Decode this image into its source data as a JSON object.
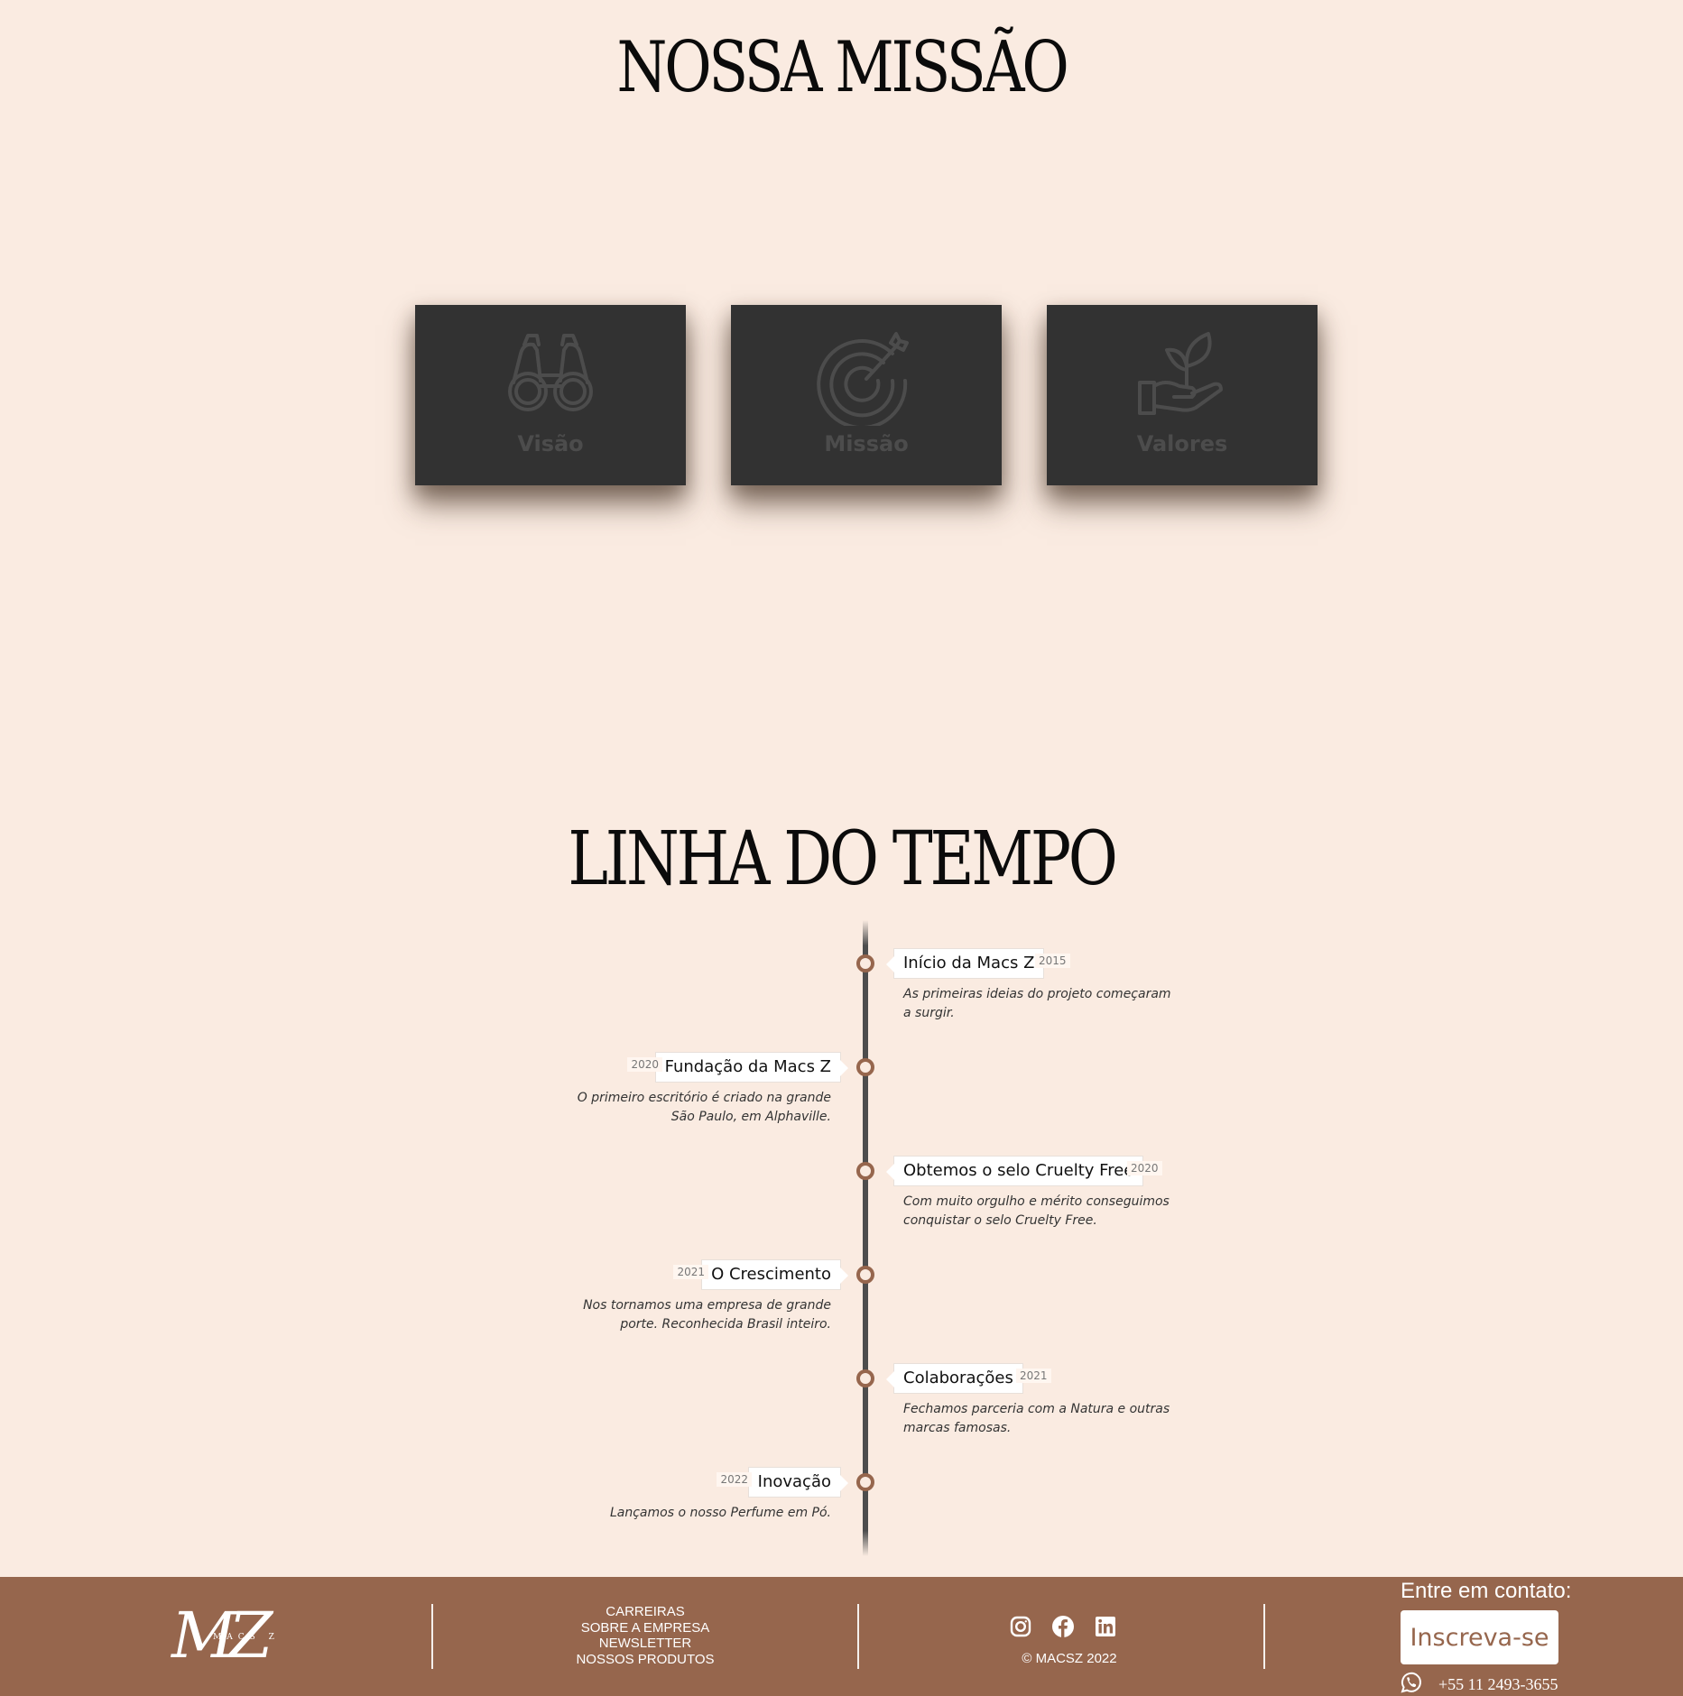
{
  "mission": {
    "title": "NOSSA MISSÃO",
    "cards": [
      {
        "label": "Visão",
        "icon": "binoculars-icon"
      },
      {
        "label": "Missão",
        "icon": "target-icon"
      },
      {
        "label": "Valores",
        "icon": "plant-hand-icon"
      }
    ]
  },
  "timeline": {
    "title": "LINHA DO TEMPO",
    "events": [
      {
        "title": "Início da Macs Z",
        "year": "2015",
        "description": "As primeiras ideias do projeto começaram a surgir.",
        "side": "right"
      },
      {
        "title": "Fundação da Macs Z",
        "year": "2020",
        "description": "O primeiro escritório é criado na grande São Paulo, em Alphaville.",
        "side": "left"
      },
      {
        "title": "Obtemos o selo Cruelty Free",
        "year": "2020",
        "description": "Com muito orgulho e mérito conseguimos conquistar o selo Cruelty Free.",
        "side": "right"
      },
      {
        "title": "O Crescimento",
        "year": "2021",
        "description": "Nos tornamos uma empresa de grande porte. Reconhecida Brasil inteiro.",
        "side": "left"
      },
      {
        "title": "Colaborações",
        "year": "2021",
        "description": "Fechamos parceria com a Natura e outras marcas famosas.",
        "side": "right"
      },
      {
        "title": "Inovação",
        "year": "2022",
        "description": "Lançamos o nosso Perfume em Pó.",
        "side": "left"
      }
    ]
  },
  "footer": {
    "logo_text": "MZ",
    "logo_small": "MACS Z",
    "links": [
      "CARREIRAS",
      "SOBRE A EMPRESA",
      "NEWSLETTER",
      "NOSSOS PRODUTOS"
    ],
    "socials": [
      "instagram-icon",
      "facebook-icon",
      "linkedin-icon"
    ],
    "copyright": "© MACSZ 2022",
    "contact_title": "Entre em contato:",
    "subscribe_label": "Inscreva-se",
    "phone": "+55 11 2493-3655",
    "colors": {
      "background": "#96664d",
      "page": "#faebe1",
      "card": "#323232"
    }
  }
}
